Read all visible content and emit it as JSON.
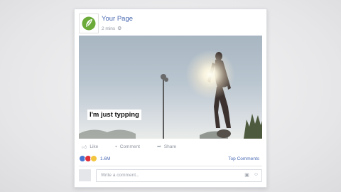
{
  "post": {
    "page_name": "Your Page",
    "timestamp": "2 mins",
    "privacy_icon": "globe-icon",
    "caption": "I'm just typping"
  },
  "actions": {
    "like_label": "Like",
    "comment_label": "Comment",
    "share_label": "Share"
  },
  "reactions": {
    "count": "1.6M",
    "types": [
      "like",
      "love",
      "wow"
    ],
    "top_comments_label": "Top Comments"
  },
  "comment_box": {
    "placeholder": "Write a comment..."
  },
  "colors": {
    "link_blue": "#4b6bb3",
    "logo_green": "#6cab3a"
  }
}
